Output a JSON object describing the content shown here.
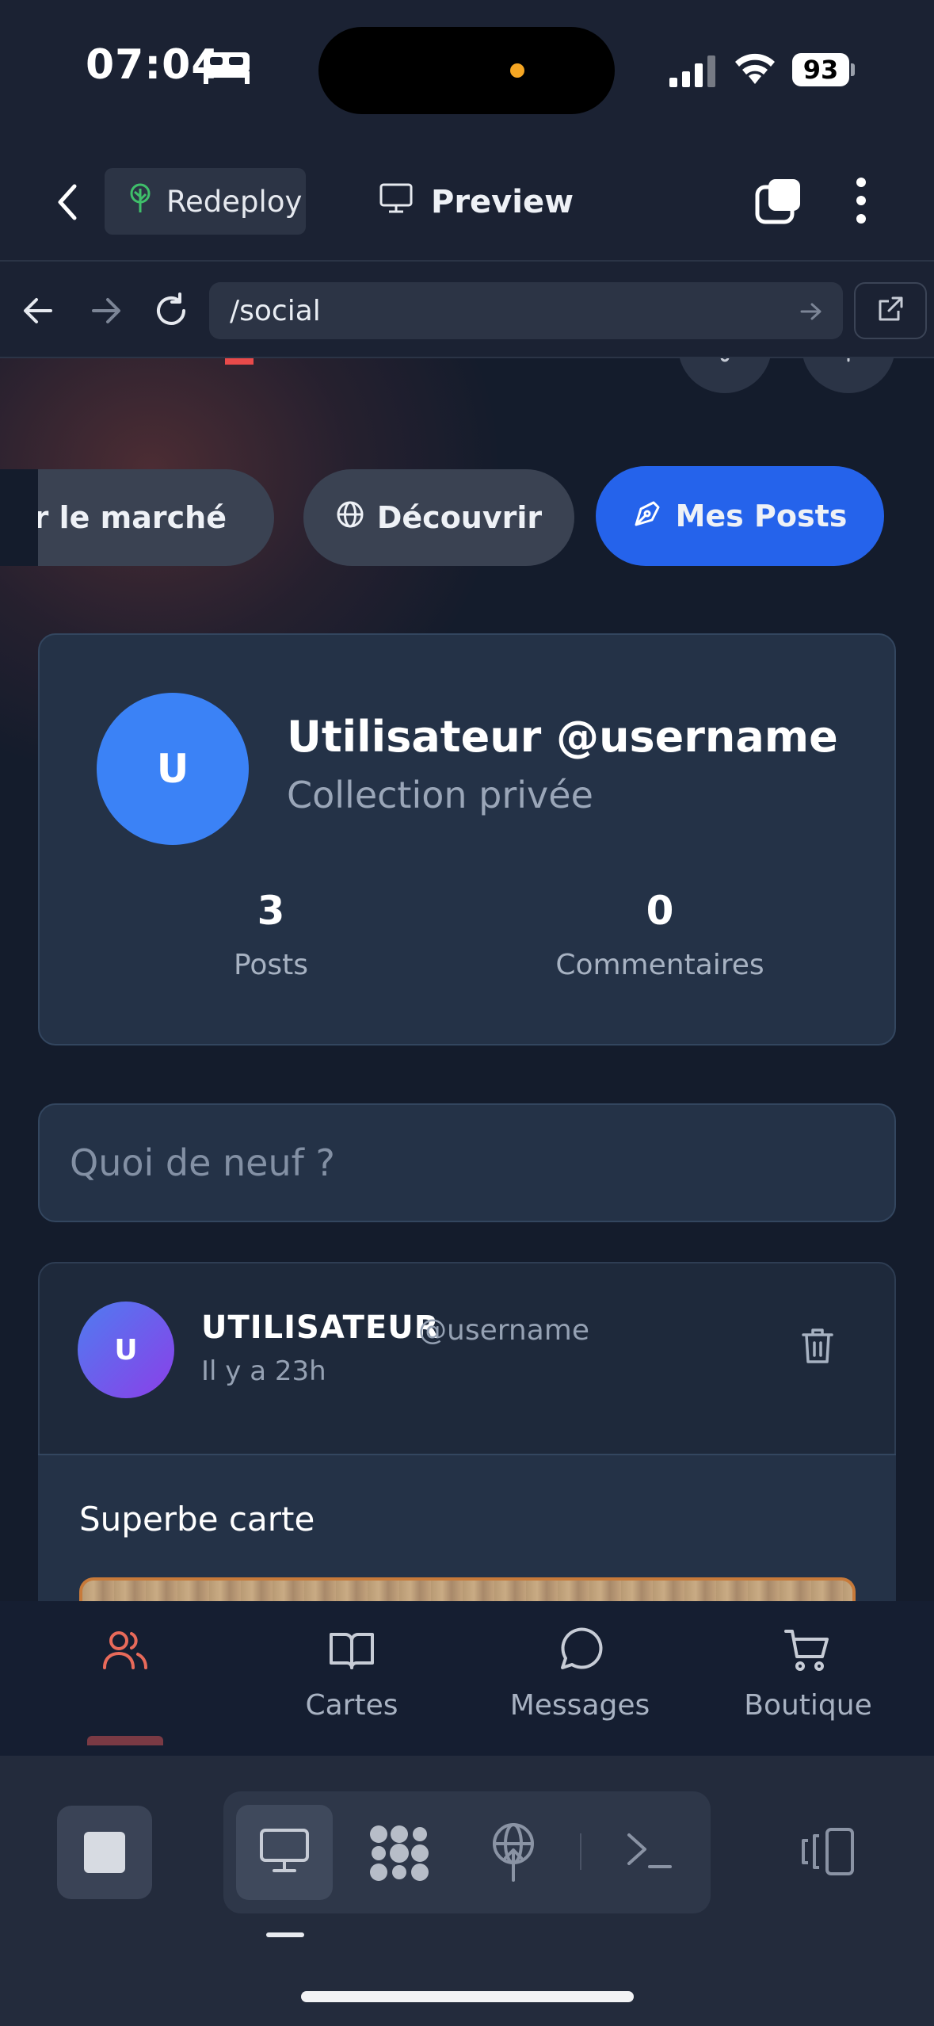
{
  "status_bar": {
    "time": "07:04",
    "battery": "93"
  },
  "app_header": {
    "redeploy_label": "Redeploy",
    "preview_label": "Preview"
  },
  "browser": {
    "url": "/social"
  },
  "page": {
    "tabs": [
      {
        "label": "Sur le marché",
        "active": false
      },
      {
        "label": "Découvrir",
        "active": false
      },
      {
        "label": "Mes Posts",
        "active": true
      }
    ]
  },
  "profile": {
    "avatar_initial": "U",
    "name": "Utilisateur @username",
    "subtitle": "Collection privée",
    "stats": [
      {
        "value": "3",
        "label": "Posts"
      },
      {
        "value": "0",
        "label": "Commentaires"
      }
    ]
  },
  "composer": {
    "placeholder": "Quoi de neuf ?"
  },
  "post": {
    "avatar_initial": "U",
    "author": "UTILISATEUR",
    "handle": "@username",
    "time": "Il y a 23h",
    "text": "Superbe carte"
  },
  "bottom_nav": {
    "items": [
      {
        "label": "",
        "icon": "users-icon",
        "active": true
      },
      {
        "label": "Cartes",
        "icon": "book-open-icon",
        "active": false
      },
      {
        "label": "Messages",
        "icon": "message-circle-icon",
        "active": false
      },
      {
        "label": "Boutique",
        "icon": "shopping-cart-icon",
        "active": false
      }
    ]
  },
  "colors": {
    "accent_blue": "#2563eb",
    "active_nav": "#e86a5a",
    "background": "#141c2c"
  }
}
